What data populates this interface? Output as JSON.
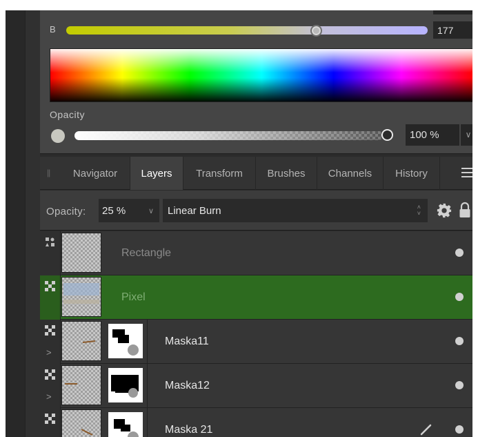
{
  "color_panel": {
    "b_label": "B",
    "b_value": "177",
    "b_level": 0.69,
    "opacity_label": "Opacity",
    "opacity_value": "100 %",
    "opacity_level": 1.0
  },
  "tabs": [
    {
      "label": "Navigator",
      "active": false
    },
    {
      "label": "Layers",
      "active": true
    },
    {
      "label": "Transform",
      "active": false
    },
    {
      "label": "Brushes",
      "active": false
    },
    {
      "label": "Channels",
      "active": false
    },
    {
      "label": "History",
      "active": false
    }
  ],
  "layer_options": {
    "opacity_label": "Opacity:",
    "opacity_value": "25 %",
    "blend_mode": "Linear Burn"
  },
  "layers": [
    {
      "name": "Rectangle",
      "dimmed": true,
      "selected": false,
      "type_icon": "shape-layer-icon",
      "has_mask": false
    },
    {
      "name": "Pixel",
      "dimmed": true,
      "selected": true,
      "type_icon": "pixel-layer-icon",
      "has_mask": false
    },
    {
      "name": "Maska11",
      "dimmed": false,
      "selected": false,
      "type_icon": "pixel-layer-icon",
      "has_mask": true
    },
    {
      "name": "Maska12",
      "dimmed": false,
      "selected": false,
      "type_icon": "pixel-layer-icon",
      "has_mask": true
    },
    {
      "name": "Maska 21",
      "dimmed": false,
      "selected": false,
      "type_icon": "pixel-layer-icon",
      "has_mask": true,
      "brush": true
    }
  ],
  "colors": {
    "selected_row": "#2d6b1f",
    "panel_bg": "#454545",
    "tab_active": "#404040"
  }
}
